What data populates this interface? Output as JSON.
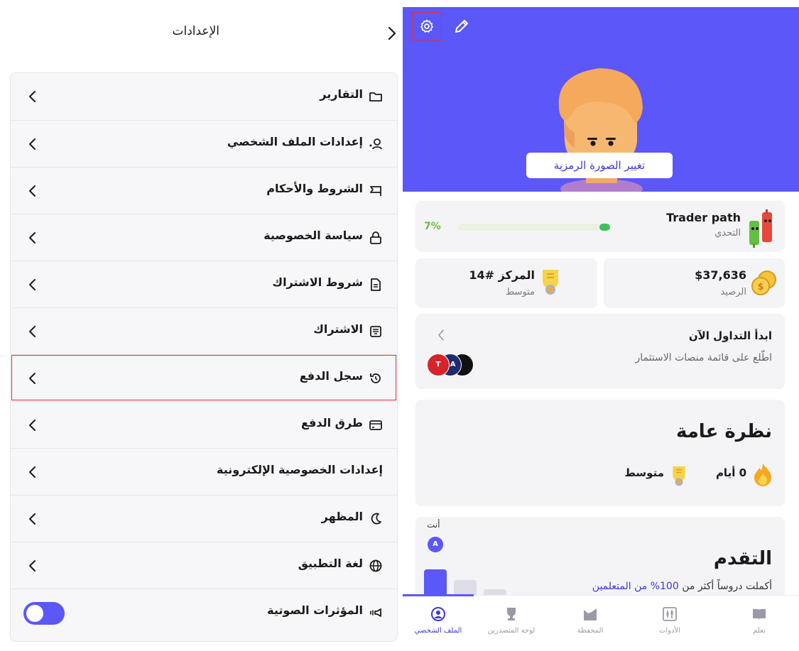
{
  "settings": {
    "title": "الإعدادات",
    "items": [
      {
        "label": "التقارير",
        "icon": "folder-icon"
      },
      {
        "label": "إعدادات الملف الشخصي",
        "icon": "user-settings-icon"
      },
      {
        "label": "الشروط والأحكام",
        "icon": "flag-icon"
      },
      {
        "label": "سياسة الخصوصية",
        "icon": "lock-icon"
      },
      {
        "label": "شروط الاشتراك",
        "icon": "document-icon"
      },
      {
        "label": "الاشتراك",
        "icon": "receipt-icon"
      },
      {
        "label": "سجل الدفع",
        "icon": "history-icon"
      },
      {
        "label": "طرق الدفع",
        "icon": "credit-card-icon"
      },
      {
        "label": "إعدادات الخصوصية الإلكترونية",
        "icon": ""
      },
      {
        "label": "المظهر",
        "icon": "moon-icon"
      },
      {
        "label": "لغة التطبيق",
        "icon": "globe-icon"
      },
      {
        "label": "المؤثرات الصوتية",
        "icon": "speaker-icon"
      }
    ],
    "sound_effects_enabled": true
  },
  "profile": {
    "change_avatar": "تغيير الصورة الرمزية",
    "trader_path": {
      "title": "Trader path",
      "subtitle": "التحدي",
      "progress_label": "7%",
      "progress": 0.07
    },
    "balance": {
      "value": "$37,636",
      "label": "الرصيد"
    },
    "rank": {
      "value": "المركز #14",
      "label": "متوسط"
    },
    "start_trading": {
      "title": "ابدأ التداول الآن",
      "subtitle": "اطّلع على قائمة منصات الاستثمار",
      "logos": [
        "T",
        "SA",
        ""
      ]
    },
    "overview": {
      "title": "نظرة عامة",
      "days": "0 أيام",
      "level": "متوسط"
    },
    "progress": {
      "title": "التقدم",
      "subtitle_prefix": "أكملت دروساً أكثر من",
      "percent": "100%",
      "subtitle_suffix": "من المتعلمين",
      "you_label": "أنت",
      "you_initial": "A",
      "bar_levels": [
        1.0,
        0.73,
        0.5,
        0.24
      ]
    },
    "nav": [
      {
        "label": "الملف الشخصي",
        "icon": "profile-icon",
        "active": true
      },
      {
        "label": "لوحة المتصدرين",
        "icon": "trophy-icon",
        "active": false
      },
      {
        "label": "المحفظة",
        "icon": "portfolio-icon",
        "active": false
      },
      {
        "label": "الأدوات",
        "icon": "tools-icon",
        "active": false
      },
      {
        "label": "تعلم",
        "icon": "book-icon",
        "active": false
      }
    ],
    "colors": {
      "accent": "#5b57f9",
      "highlight": "#e03131",
      "progress_green": "#43c058"
    }
  }
}
